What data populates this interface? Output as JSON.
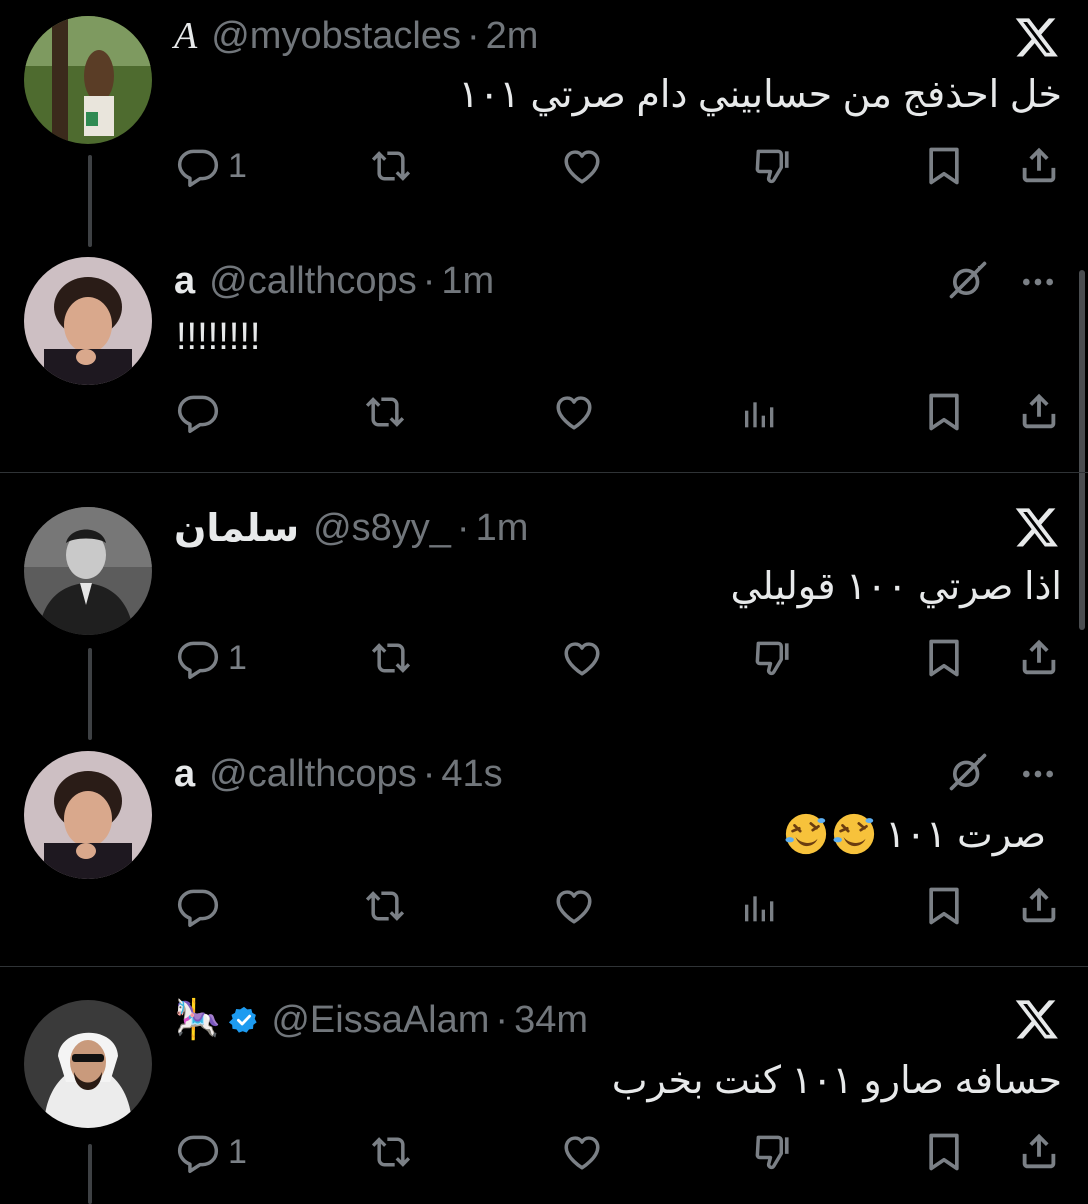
{
  "tweets": [
    {
      "name": "A",
      "handle": "@myobstacles",
      "separator": "·",
      "time": "2m",
      "text": "خل احذفج من حسابيني دام صرتي ١٠١",
      "reply_count": "1"
    },
    {
      "name": "a",
      "handle": "@callthcops",
      "separator": "·",
      "time": "1m",
      "text": "!!!!!!!!",
      "reply_count": ""
    },
    {
      "name": "سلمان",
      "handle": "@s8yy_",
      "separator": "·",
      "time": "1m",
      "text": "اذا صرتي ١٠٠ قوليلي",
      "reply_count": "1"
    },
    {
      "name": "a",
      "handle": "@callthcops",
      "separator": "·",
      "time": "41s",
      "text": "صرت ١٠١",
      "reply_count": ""
    },
    {
      "name": "🎠",
      "handle": "@EissaAlam",
      "separator": "·",
      "time": "34m",
      "text": "حسافه صارو ١٠١ كنت بخرب",
      "reply_count": "1"
    }
  ],
  "colors": {
    "background": "#000000",
    "primary_text": "#e7e9ea",
    "secondary_text": "#71767b",
    "icon": "#7b8086",
    "verified": "#1d9bf0",
    "divider": "#2f3336"
  },
  "icons": {
    "reply": "reply-icon",
    "repost": "repost-icon",
    "like": "like-icon",
    "dislike": "dislike-icon",
    "views": "views-icon",
    "bookmark": "bookmark-icon",
    "share": "share-icon",
    "x_logo": "x-logo-icon",
    "more": "more-icon",
    "grok": "grok-icon",
    "verified": "verified-badge-icon"
  }
}
